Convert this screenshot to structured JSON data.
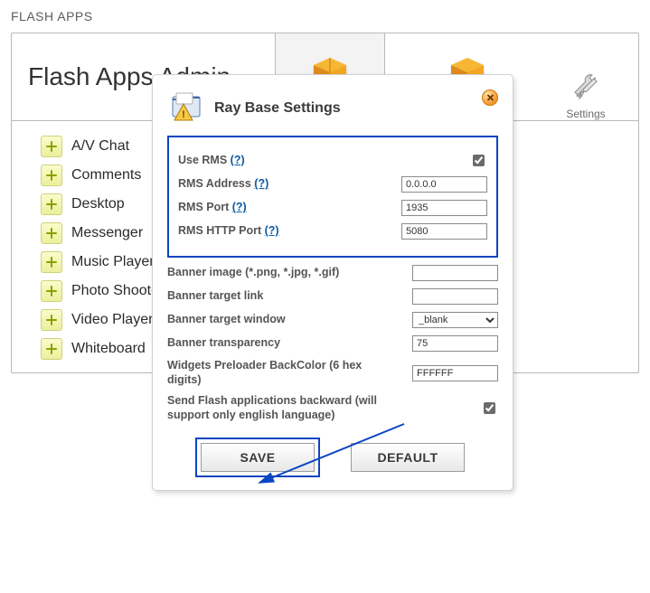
{
  "section_title": "FLASH APPS",
  "card_title": "Flash Apps Admin",
  "settings_label": "Settings",
  "apps": [
    {
      "label": "A/V Chat"
    },
    {
      "label": "Comments"
    },
    {
      "label": "Desktop"
    },
    {
      "label": "Messenger"
    },
    {
      "label": "Music Player"
    },
    {
      "label": "Photo Shooter"
    },
    {
      "label": "Video Player"
    },
    {
      "label": "Whiteboard"
    }
  ],
  "dialog": {
    "title": "Ray Base Settings",
    "help_q": "(?)",
    "rows": {
      "use_rms_label": "Use RMS",
      "use_rms_checked": true,
      "rms_address_label": "RMS Address",
      "rms_address_value": "0.0.0.0",
      "rms_port_label": "RMS Port",
      "rms_port_value": "1935",
      "rms_http_port_label": "RMS HTTP Port",
      "rms_http_port_value": "5080",
      "banner_image_label": "Banner image (*.png, *.jpg, *.gif)",
      "banner_image_value": "",
      "banner_link_label": "Banner target link",
      "banner_link_value": "",
      "banner_window_label": "Banner target window",
      "banner_window_value": "_blank",
      "banner_transparency_label": "Banner transparency",
      "banner_transparency_value": "75",
      "preloader_label": "Widgets Preloader BackColor (6 hex digits)",
      "preloader_value": "FFFFFF",
      "send_backward_label": "Send Flash applications backward (will support only english language)",
      "send_backward_checked": true
    },
    "save_label": "SAVE",
    "default_label": "DEFAULT"
  }
}
